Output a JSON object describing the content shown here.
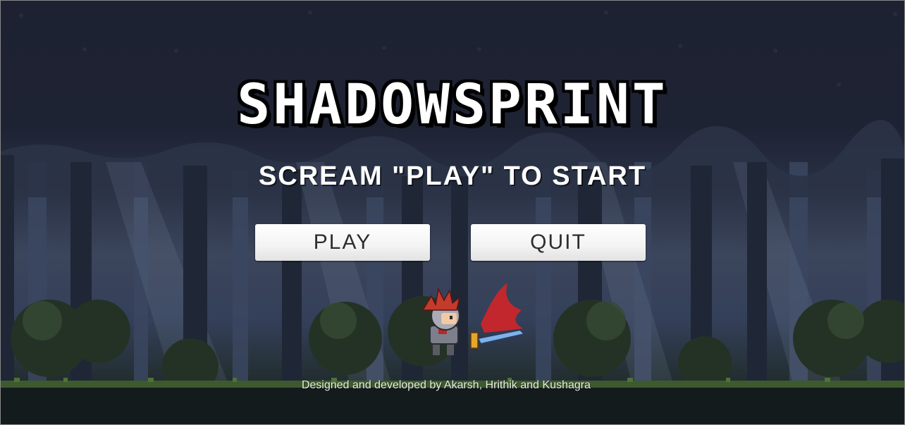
{
  "game": {
    "title": "SHADOWSPRINT",
    "instruction": "SCREAM \"PLAY\" TO START",
    "credits": "Designed and developed by Akarsh, Hrithik and Kushagra"
  },
  "menu": {
    "play_label": "PLAY",
    "quit_label": "QUIT"
  },
  "character": {
    "icon": "knight-with-sword-icon"
  },
  "colors": {
    "sky": "#1d2131",
    "fog": "#3b455b",
    "foliage": "#2c3b33",
    "grass": "#3f5a30",
    "button": "#f3f3f3",
    "button_text": "#2e2e2e",
    "title_text": "#ffffff"
  }
}
